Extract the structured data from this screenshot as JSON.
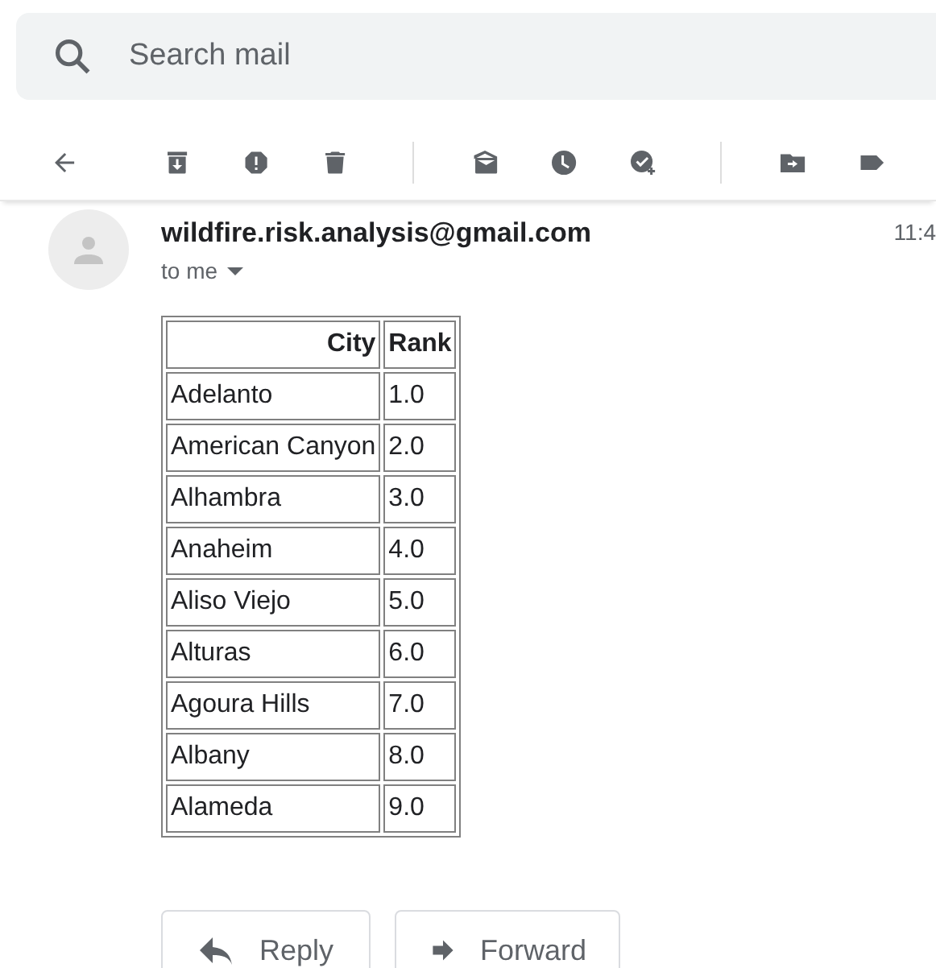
{
  "search": {
    "placeholder": "Search mail"
  },
  "message": {
    "sender": "wildfire.risk.analysis@gmail.com",
    "time": "11:4",
    "recipient": "to me"
  },
  "table": {
    "columns": [
      "City",
      "Rank"
    ],
    "rows": [
      [
        "Adelanto",
        "1.0"
      ],
      [
        "American Canyon",
        "2.0"
      ],
      [
        "Alhambra",
        "3.0"
      ],
      [
        "Anaheim",
        "4.0"
      ],
      [
        "Aliso Viejo",
        "5.0"
      ],
      [
        "Alturas",
        "6.0"
      ],
      [
        "Agoura Hills",
        "7.0"
      ],
      [
        "Albany",
        "8.0"
      ],
      [
        "Alameda",
        "9.0"
      ]
    ]
  },
  "actions": [
    {
      "kind": "reply",
      "label": "Reply"
    },
    {
      "kind": "forward",
      "label": "Forward"
    }
  ]
}
